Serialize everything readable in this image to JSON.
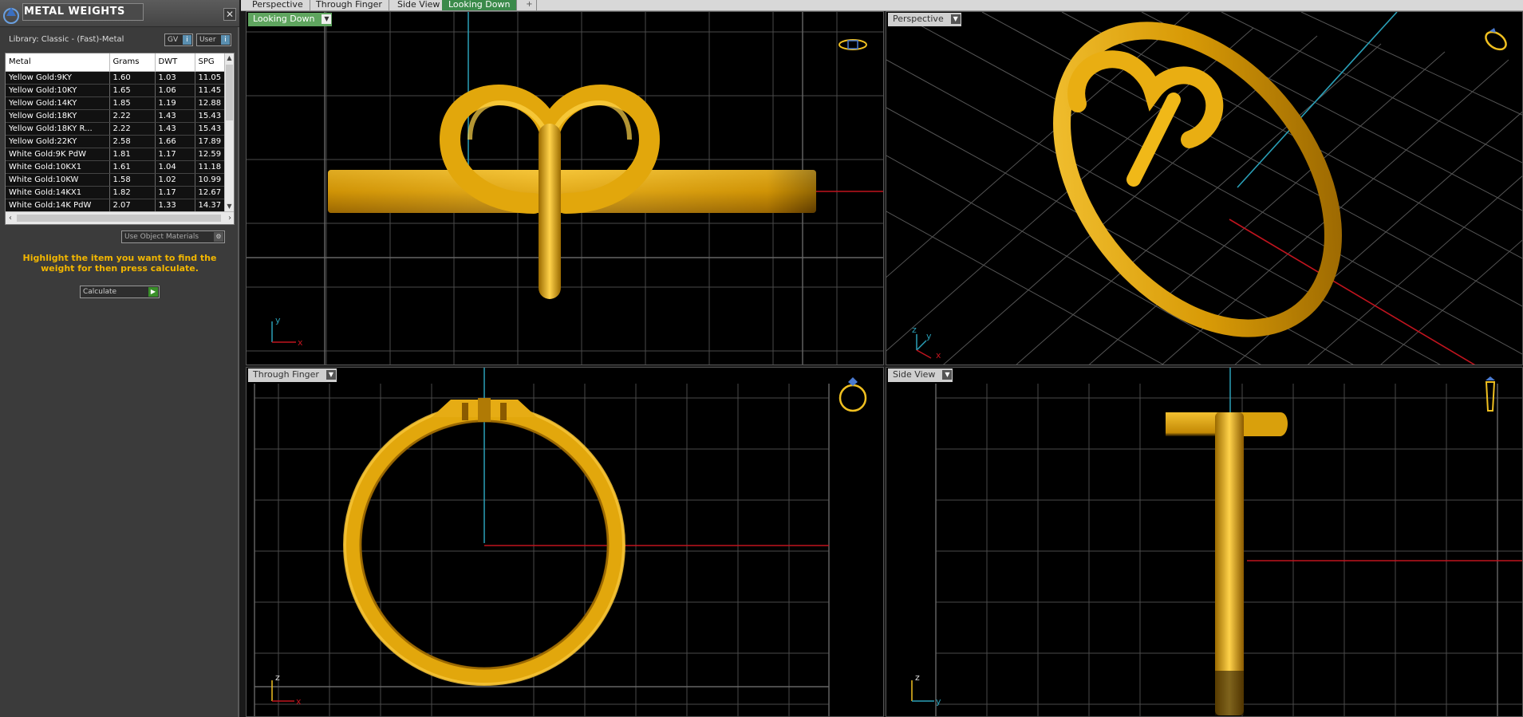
{
  "panel": {
    "title": "METAL WEIGHTS",
    "close": "✕",
    "library": "Library: Classic - (Fast)-Metal",
    "toggle_gv": "GV",
    "toggle_user": "User",
    "toggle_knob": "i",
    "use_object_materials": "Use Object Materials",
    "hint": "Highlight the item you want to find the weight for then press calculate.",
    "calculate": "Calculate"
  },
  "table": {
    "columns": [
      "Metal",
      "Grams",
      "DWT",
      "SPG"
    ],
    "rows": [
      [
        "Yellow Gold:9KY",
        "1.60",
        "1.03",
        "11.05"
      ],
      [
        "Yellow Gold:10KY",
        "1.65",
        "1.06",
        "11.45"
      ],
      [
        "Yellow Gold:14KY",
        "1.85",
        "1.19",
        "12.88"
      ],
      [
        "Yellow Gold:18KY",
        "2.22",
        "1.43",
        "15.43"
      ],
      [
        "Yellow Gold:18KY R...",
        "2.22",
        "1.43",
        "15.43"
      ],
      [
        "Yellow Gold:22KY",
        "2.58",
        "1.66",
        "17.89"
      ],
      [
        "White Gold:9K PdW",
        "1.81",
        "1.17",
        "12.59"
      ],
      [
        "White Gold:10KX1",
        "1.61",
        "1.04",
        "11.18"
      ],
      [
        "White Gold:10KW",
        "1.58",
        "1.02",
        "10.99"
      ],
      [
        "White Gold:14KX1",
        "1.82",
        "1.17",
        "12.67"
      ],
      [
        "White Gold:14K PdW",
        "2.07",
        "1.33",
        "14.37"
      ]
    ]
  },
  "tabs": [
    {
      "label": "Perspective",
      "active": false
    },
    {
      "label": "Through Finger",
      "active": false
    },
    {
      "label": "Side View",
      "active": false
    },
    {
      "label": "Looking Down",
      "active": true
    }
  ],
  "tab_add": "+",
  "viewports": {
    "top_left": {
      "label": "Looking Down",
      "axis_h": "x",
      "axis_v": "y"
    },
    "top_right": {
      "label": "Perspective",
      "axis_h": "x",
      "axis_v": "y",
      "axis_z": "z"
    },
    "bottom_left": {
      "label": "Through Finger",
      "axis_h": "x",
      "axis_v": "z"
    },
    "bottom_right": {
      "label": "Side View",
      "axis_h": "y",
      "axis_v": "z"
    }
  },
  "colors": {
    "gold": "#e0a80f",
    "grid": "#4a4a4a",
    "axis_red": "#c0141e",
    "axis_cyan": "#2aa0b8",
    "hint_yellow": "#f2b600"
  }
}
